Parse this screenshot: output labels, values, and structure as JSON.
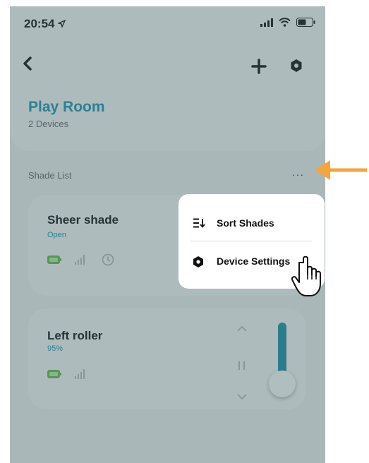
{
  "status_bar": {
    "time": "20:54"
  },
  "room": {
    "title": "Play Room",
    "subtitle": "2 Devices"
  },
  "list": {
    "label": "Shade List",
    "more": "···"
  },
  "shades": [
    {
      "name": "Sheer shade",
      "status": "Open"
    },
    {
      "name": "Left roller",
      "status": "95%",
      "position_percent": 95
    }
  ],
  "menu": {
    "sort_label": "Sort Shades",
    "settings_label": "Device Settings"
  },
  "colors": {
    "accent": "#1797b1",
    "battery": "#5cc23a",
    "annotation_arrow": "#f5a53a"
  },
  "icons": [
    "location-arrow-icon",
    "cellular-icon",
    "wifi-icon",
    "battery-icon",
    "back-icon",
    "plus-icon",
    "gear-icon",
    "sort-icon",
    "signal-icon",
    "clock-icon",
    "chevron-up-icon",
    "pause-icon",
    "chevron-down-icon",
    "hand-cursor-icon"
  ]
}
